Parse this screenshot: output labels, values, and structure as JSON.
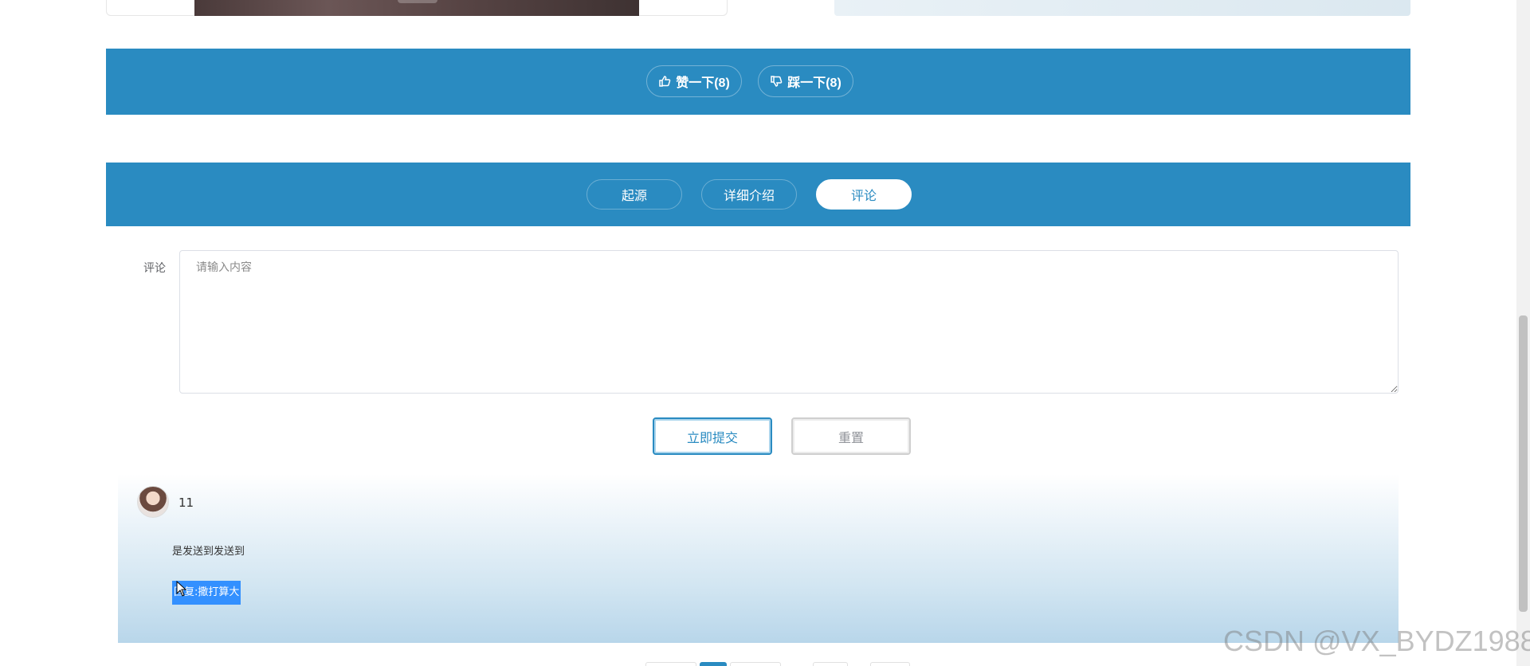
{
  "vote": {
    "like_label": "赞一下(8)",
    "dislike_label": "踩一下(8)"
  },
  "tabs": [
    {
      "label": "起源",
      "active": false
    },
    {
      "label": "详细介绍",
      "active": false
    },
    {
      "label": "评论",
      "active": true
    }
  ],
  "comment_form": {
    "label": "评论",
    "placeholder": "请输入内容",
    "submit_label": "立即提交",
    "reset_label": "重置"
  },
  "comments": [
    {
      "user": "11",
      "text": "是发送到发送到",
      "reply": "回复:撒打算大"
    }
  ],
  "watermark": "CSDN @VX_BYDZ1988",
  "colors": {
    "accent": "#2a8bc1",
    "selection": "#3390ff"
  }
}
